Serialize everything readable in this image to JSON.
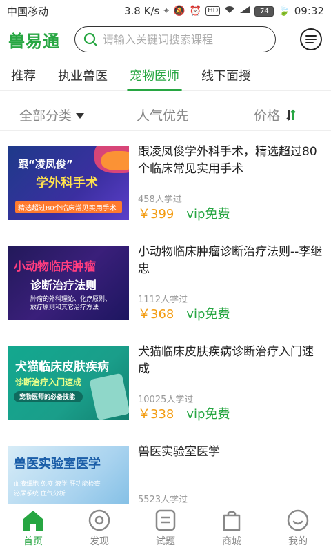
{
  "status_bar": {
    "carrier": "中国移动",
    "speed": "3.8 K/s",
    "battery": "74",
    "time": "09:32"
  },
  "header": {
    "logo": "兽易通",
    "search_placeholder": "请输入关键词搜索课程"
  },
  "tabs": [
    {
      "label": "推荐",
      "active": false
    },
    {
      "label": "执业兽医",
      "active": false
    },
    {
      "label": "宠物医师",
      "active": true
    },
    {
      "label": "线下面授",
      "active": false
    }
  ],
  "filters": {
    "category": "全部分类",
    "popular": "人气优先",
    "price": "价格"
  },
  "courses": [
    {
      "thumb_line1": "跟“凌凤俊”",
      "thumb_line2": "学外科手术",
      "thumb_line3": "精选超过80个临床常见实用手术",
      "title": "跟凌凤俊学外科手术，精选超过80个临床常见实用手术",
      "learners": "458人学过",
      "price": "￥399",
      "vip": "vip免费"
    },
    {
      "thumb_line1": "小动物临床肿瘤",
      "thumb_line2": "诊断治疗法则",
      "thumb_line3": "肿瘤的外科理论、化疗原则、放疗原则和其它治疗方法",
      "title": "小动物临床肿瘤诊断治疗法则--李继忠",
      "learners": "1112人学过",
      "price": "￥368",
      "vip": "vip免费"
    },
    {
      "thumb_line1": "犬猫临床皮肤疾病",
      "thumb_line2": "诊断治疗入门速成",
      "thumb_line3": "宠物医师的必备技能",
      "title": "犬猫临床皮肤疾病诊断治疗入门速成",
      "learners": "10025人学过",
      "price": "￥338",
      "vip": "vip免费"
    },
    {
      "thumb_line1": "兽医实验室医学",
      "thumb_line2": "血液细胞 免疫 液学 肝功能检查",
      "thumb_line3": "泌尿系统 血气分析",
      "title": "兽医实验室医学",
      "learners": "5523人学过",
      "price": "",
      "vip": ""
    }
  ],
  "bottom_nav": [
    {
      "label": "首页",
      "icon": "home-icon",
      "active": true
    },
    {
      "label": "发现",
      "icon": "discover-icon",
      "active": false
    },
    {
      "label": "试题",
      "icon": "exam-icon",
      "active": false
    },
    {
      "label": "商城",
      "icon": "shop-bag-icon",
      "active": false
    },
    {
      "label": "我的",
      "icon": "profile-smile-icon",
      "active": false
    }
  ],
  "colors": {
    "brand_green": "#27a642",
    "price_orange": "#f39c12"
  }
}
